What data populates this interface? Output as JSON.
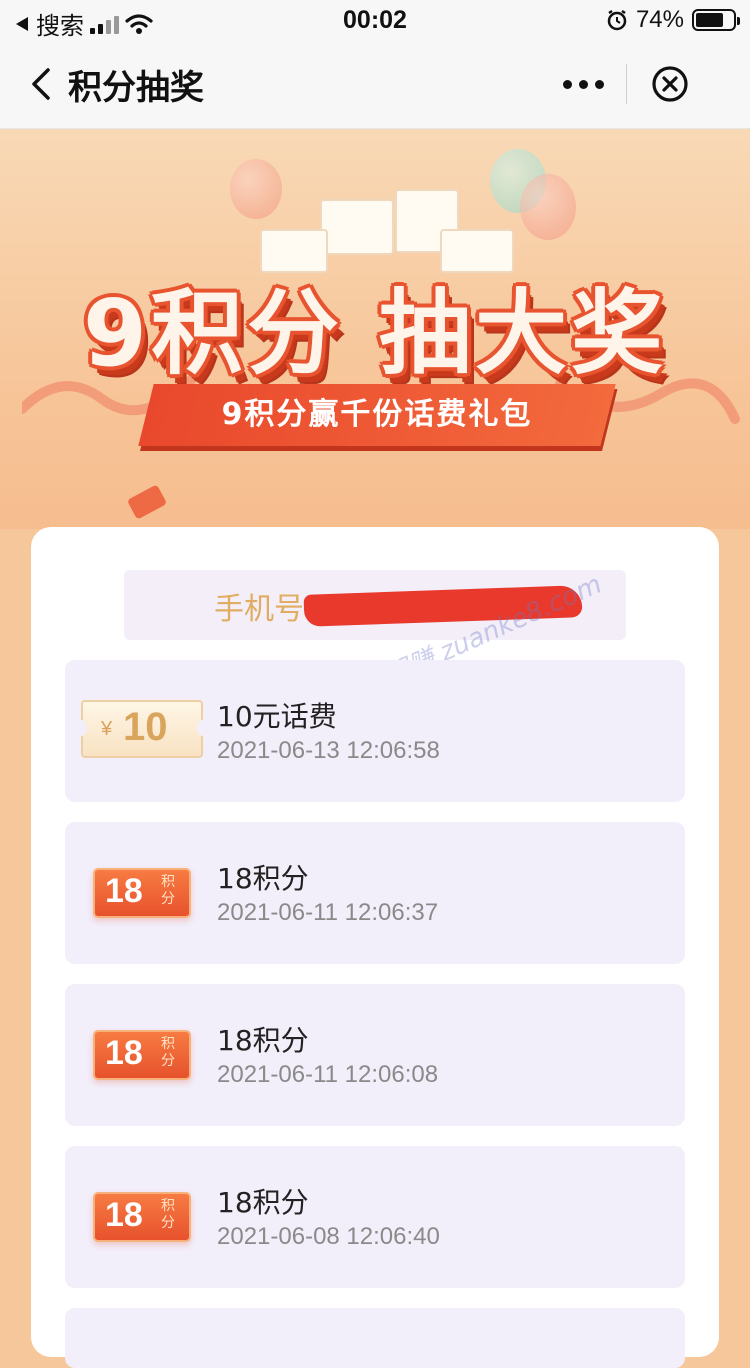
{
  "status_bar": {
    "back_app": "搜索",
    "time": "00:02",
    "battery": "74%",
    "battery_level": 0.74
  },
  "nav": {
    "title": "积分抽奖"
  },
  "banner": {
    "headline": "9积分 抽大奖",
    "subline": "9积分赢千份话费礼包"
  },
  "phone": {
    "label": "手机号"
  },
  "watermark": "赚客吧，有奖一起赚 zuanke8.com",
  "records": [
    {
      "coupon_type": "cash",
      "coupon_currency": "¥",
      "coupon_amount": "10",
      "title": "10元话费",
      "time": "2021-06-13 12:06:58"
    },
    {
      "coupon_type": "points",
      "coupon_amount": "18",
      "coupon_unit": "积分",
      "title": "18积分",
      "time": "2021-06-11 12:06:37"
    },
    {
      "coupon_type": "points",
      "coupon_amount": "18",
      "coupon_unit": "积分",
      "title": "18积分",
      "time": "2021-06-11 12:06:08"
    },
    {
      "coupon_type": "points",
      "coupon_amount": "18",
      "coupon_unit": "积分",
      "title": "18积分",
      "time": "2021-06-08 12:06:40"
    }
  ],
  "colors": {
    "accent_orange": "#e9482c",
    "gold_text": "#e0ad63",
    "item_bg": "#f2eefa"
  }
}
